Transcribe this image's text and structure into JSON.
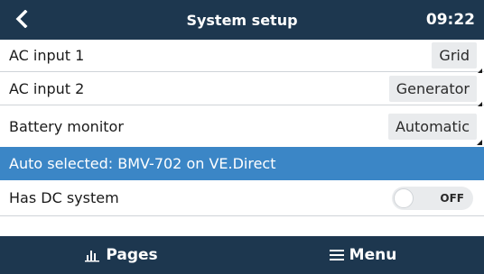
{
  "header": {
    "title": "System setup",
    "time": "09:22",
    "back_icon": "chevron-left-icon"
  },
  "rows": [
    {
      "label": "AC input 1",
      "value": "Grid"
    },
    {
      "label": "AC input 2",
      "value": "Generator"
    },
    {
      "label": "Battery monitor",
      "value": "Automatic"
    },
    {
      "label": "Auto selected: BMV-702 on VE.Direct"
    },
    {
      "label": "Has DC system",
      "toggle": "OFF"
    }
  ],
  "footer": {
    "pages_label": "Pages",
    "pages_icon": "bar-chart-icon",
    "menu_label": "Menu",
    "menu_icon": "hamburger-icon"
  },
  "colors": {
    "header_bg": "#1d374f",
    "selected_row_bg": "#3b86c6",
    "value_box_bg": "#e9ebed"
  }
}
